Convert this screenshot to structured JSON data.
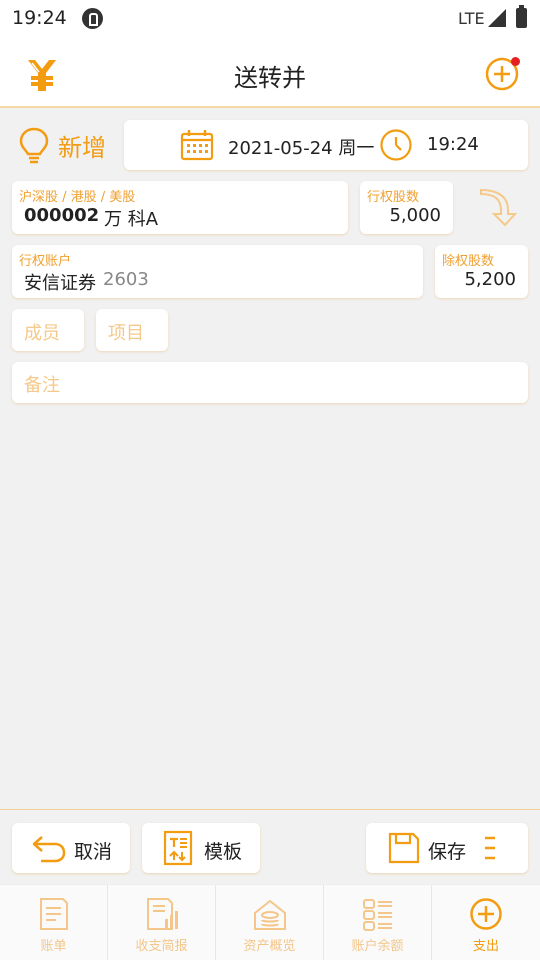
{
  "status_bar": {
    "time": "19:24",
    "network": "LTE"
  },
  "app_bar": {
    "title": "送转并",
    "logo_icon": "yen-coin-stack-icon",
    "add_icon": "add-circle-icon",
    "badge_color": "#e52020"
  },
  "entry": {
    "mode_label": "新增",
    "date": "2021-05-24 周一",
    "time": "19:24"
  },
  "stock": {
    "market_label": "沪深股 / 港股 / 美股",
    "code": "000002",
    "name": "万 科A"
  },
  "exercise_shares": {
    "label": "行权股数",
    "value": "5,000"
  },
  "account": {
    "label": "行权账户",
    "name": "安信证券",
    "suffix": "2603"
  },
  "ex_shares": {
    "label": "除权股数",
    "value": "5,200"
  },
  "fields": {
    "member_placeholder": "成员",
    "project_placeholder": "项目",
    "note_placeholder": "备注"
  },
  "actions": {
    "cancel": "取消",
    "template": "模板",
    "save": "保存"
  },
  "tabs": [
    {
      "label": "账单",
      "icon": "document-icon"
    },
    {
      "label": "收支简报",
      "icon": "report-chart-icon"
    },
    {
      "label": "资产概览",
      "icon": "asset-house-icon"
    },
    {
      "label": "账户余额",
      "icon": "account-list-icon"
    },
    {
      "label": "支出",
      "icon": "add-circle-icon",
      "active": true
    }
  ],
  "colors": {
    "accent": "#f39c12",
    "accent_light": "#f5c98a",
    "background": "#f1f1f1"
  }
}
